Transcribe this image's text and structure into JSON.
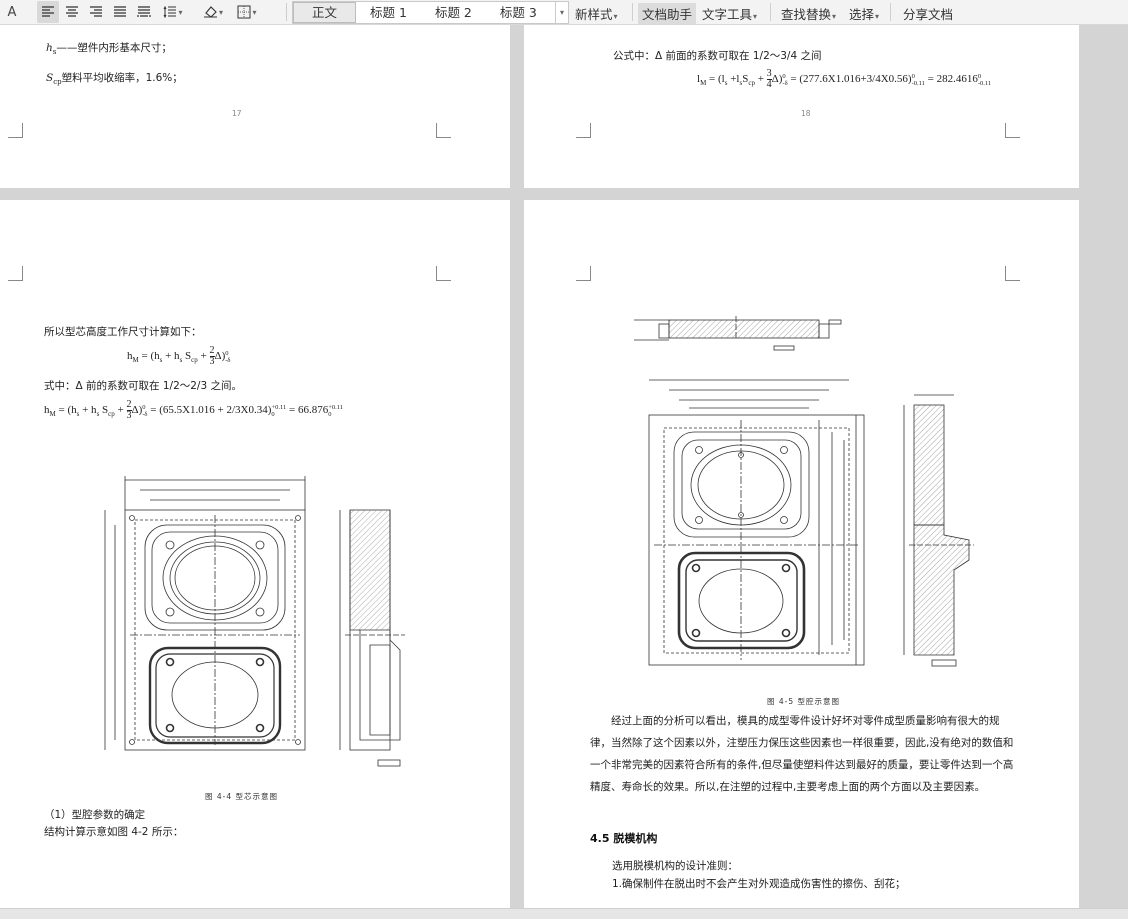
{
  "toolbar": {
    "styles": [
      "正文",
      "标题 1",
      "标题 2",
      "标题 3"
    ],
    "new_style": "新样式",
    "doc_assistant": "文档助手",
    "text_tools": "文字工具",
    "find_replace": "查找替换",
    "select": "选择",
    "share": "分享文档"
  },
  "page_tl": {
    "line1_var": "h",
    "line1_sub": "s",
    "line1_text": "——塑件内形基本尺寸；",
    "line2_var": "S",
    "line2_sub": "cp",
    "line2_text": "塑料平均收缩率，1.6%；",
    "page_number": "17"
  },
  "page_tr": {
    "line1": "公式中：Δ 前面的系数可取在 1/2～3/4 之间",
    "formula": "l_M = (l_s + l_s S_cp + 3/4 Δ)^0_-δz = (277.6X1.016+3/4X0.56)^0_-0.11 = 282.4616^0_-0.11",
    "formula_parts": {
      "lhs": "l",
      "lhs_sub": "M",
      "mid": " = (l",
      "s1": "s",
      "plus": " +l",
      "s2": "s",
      "S": "S",
      "cp": "cp",
      "frac_plus": " + ",
      "num": "3",
      "den": "4",
      "delta": "Δ)",
      "sup0": "0",
      "subd": "-δ",
      "eq2": " = (277.6X1.016+3/4X0.56)",
      "sup0b": "0",
      "sub011": "-0.11",
      "eq3": " = 282.4616",
      "sup0c": "0",
      "sub011b": "-0.11"
    },
    "page_number": "18"
  },
  "page_bl": {
    "intro": "所以型芯高度工作尺寸计算如下：",
    "formula1": {
      "lhs": "h",
      "lhs_sub": "M",
      "mid": " = (h",
      "s1": "s",
      "plus": " + h",
      "s2": "s",
      "S": " S",
      "cp": "cp",
      "frac_plus": " + ",
      "num": "2",
      "den": "3",
      "delta": "Δ)",
      "sup": "0",
      "sub": "-δ"
    },
    "note": "式中：Δ 前的系数可取在 1/2～2/3 之间。",
    "formula2": {
      "lhs": "h",
      "lhs_sub": "M",
      "mid": " = (h",
      "s1": "s",
      "plus": " + h",
      "s2": "s",
      "S": " S",
      "cp": "cp",
      "frac_plus": " + ",
      "num": "2",
      "den": "3",
      "delta": "Δ)",
      "sup": "0",
      "sub": "-δ",
      "rhs": " = (65.5X1.016 + 2/3X0.34)",
      "rsup": "+0.11",
      "rsub": "0",
      "res": " = 66.876",
      "res_sup": "+0.11",
      "res_sub": "0"
    },
    "figure_caption": "图 4-4 型芯示意图",
    "item1": "（1）型腔参数的确定",
    "item2": "结构计算示意如图 4-2 所示："
  },
  "page_br": {
    "figure_caption": "图 4-5 型腔示意图",
    "paragraph": "经过上面的分析可以看出，模具的成型零件设计好坏对零件成型质量影响有很大的规律，当然除了这个因素以外，注塑压力保压这些因素也一样很重要，因此,没有绝对的数值和一个非常完美的因素符合所有的条件,但尽量使塑料件达到最好的质量，要让零件达到一个高精度、寿命长的效果。所以,在注塑的过程中,主要考虑上面的两个方面以及主要因素。",
    "heading": "4.5 脱模机构",
    "line1": "选用脱模机构的设计准则：",
    "line2": "1.确保制件在脱出时不会产生对外观造成伤害性的擦伤、刮花；"
  }
}
